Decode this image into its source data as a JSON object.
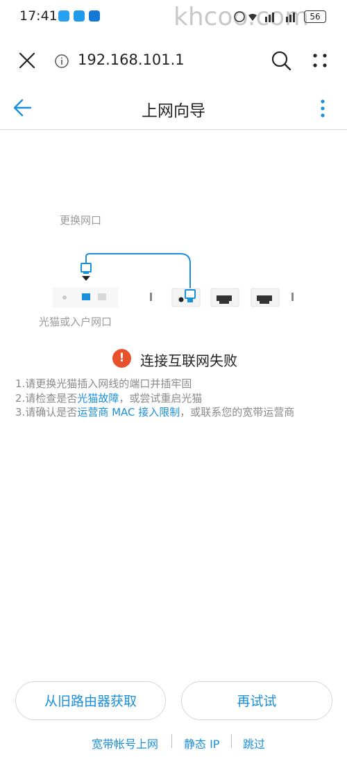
{
  "status_bar": {
    "time": "17:41",
    "battery": "56",
    "watermark": "khcoo.com"
  },
  "browser": {
    "url": "192.168.101.1"
  },
  "header": {
    "title": "上网向导"
  },
  "diagram": {
    "replace_port_label": "更换网口",
    "modem_port_label": "光猫或入户网口"
  },
  "error": {
    "icon_glyph": "!",
    "title": "连接互联网失败",
    "tips": [
      {
        "prefix": "1.请更换光猫插入网线的端口并插牢固",
        "link": "",
        "suffix": ""
      },
      {
        "prefix": "2.请检查是否",
        "link": "光猫故障",
        "suffix": "，或尝试重启光猫"
      },
      {
        "prefix": "3.请确认是否",
        "link": "运营商 MAC 接入限制",
        "suffix": "，或联系您的宽带运营商"
      }
    ]
  },
  "buttons": {
    "get_from_old": "从旧路由器获取",
    "retry": "再试试"
  },
  "footer": {
    "pppoe": "宽带帐号上网",
    "static_ip": "静态 IP",
    "skip": "跳过"
  },
  "colors": {
    "accent": "#1a8fdc",
    "error": "#e8512a"
  }
}
